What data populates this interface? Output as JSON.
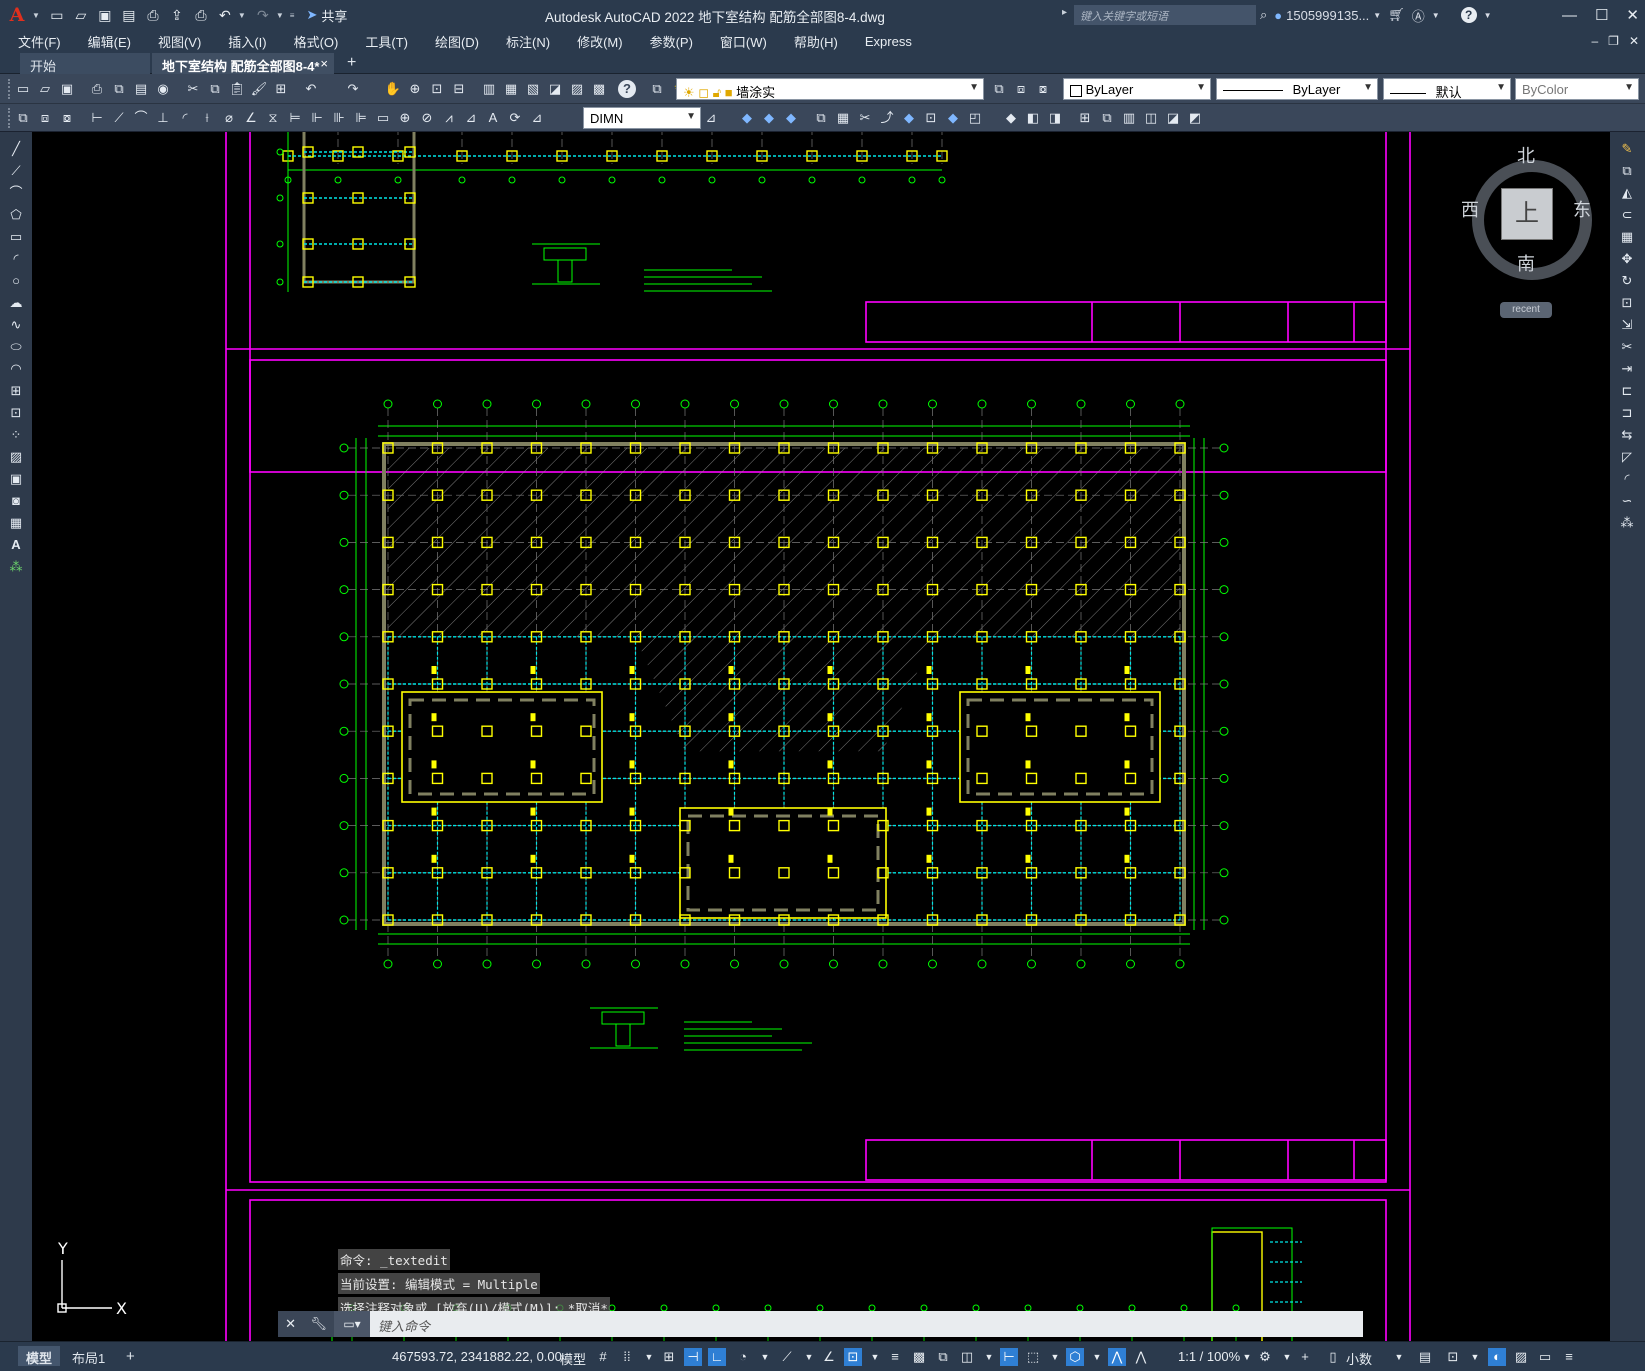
{
  "titlebar": {
    "app_logo": "A",
    "share_label": "共享",
    "title": "Autodesk AutoCAD 2022    地下室结构 配筋全部图8-4.dwg",
    "search_placeholder": "键入关键字或短语",
    "user": "1505999135...",
    "help_icon": "?"
  },
  "menubar": {
    "items": [
      "文件(F)",
      "编辑(E)",
      "视图(V)",
      "插入(I)",
      "格式(O)",
      "工具(T)",
      "绘图(D)",
      "标注(N)",
      "修改(M)",
      "参数(P)",
      "窗口(W)",
      "帮助(H)",
      "Express"
    ]
  },
  "tabs": {
    "start": "开始",
    "active": "地下室结构 配筋全部图8-4*",
    "close": "×",
    "add": "+"
  },
  "toolbar": {
    "layer_name": "墙涂实",
    "color": "ByLayer",
    "linetype": "ByLayer",
    "lineweight": "默认",
    "plotstyle": "ByColor",
    "dimstyle": "DIMN"
  },
  "viewcube": {
    "north": "北",
    "south": "南",
    "east": "东",
    "west": "西",
    "top": "上",
    "recent": "recent"
  },
  "ucs": {
    "y": "Y",
    "x": "X"
  },
  "command": {
    "history": [
      "命令: _textedit",
      "当前设置: 编辑模式 = Multiple",
      "选择注释对象或 [放弃(U)/模式(M)]: *取消*"
    ],
    "placeholder": "键入命令"
  },
  "statusbar": {
    "model_tab": "模型",
    "layout_tab": "布局1",
    "add": "+",
    "coords": "467593.72, 2341882.22, 0.00",
    "space": "模型",
    "scale": "1:1 / 100%",
    "units": "小数"
  },
  "colors": {
    "frame": "#ff00ff",
    "grid_axis": "#00ff00",
    "column": "#ffff00",
    "rebar": "#00e5e5",
    "wall": "#808060",
    "titlebar": "#2b3a4d"
  }
}
